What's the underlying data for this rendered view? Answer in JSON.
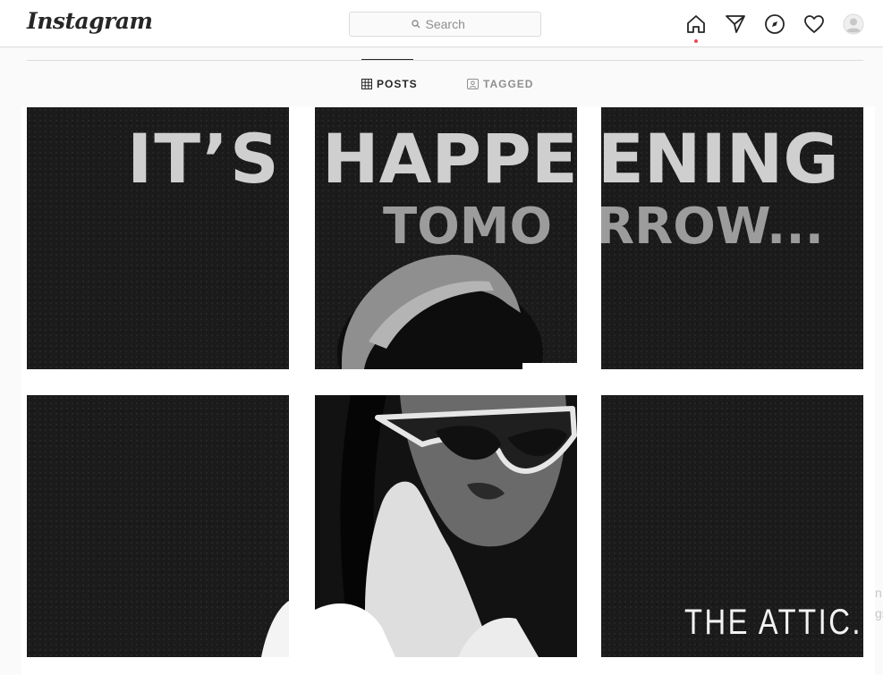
{
  "navbar": {
    "logo_text": "Instagram",
    "search_placeholder": "Search",
    "icons": [
      "home-icon",
      "direct-message-icon",
      "explore-compass-icon",
      "activity-heart-icon",
      "profile-avatar-icon"
    ]
  },
  "profile_tabs": [
    {
      "label": "POSTS",
      "icon": "grid-icon",
      "active": true
    },
    {
      "label": "TAGGED",
      "icon": "tagged-person-icon",
      "active": false
    }
  ],
  "posts": [
    {
      "id": 1,
      "text_line1": "IT’S",
      "text_line2": ""
    },
    {
      "id": 2,
      "text_line1": "HAPPE",
      "text_line2": "TOMO"
    },
    {
      "id": 3,
      "text_line1": "ENING",
      "text_line2": "RROW..."
    },
    {
      "id": 4,
      "text_line1": "",
      "text_line2": ""
    },
    {
      "id": 5,
      "text_line1": "",
      "text_line2": ""
    },
    {
      "id": 6,
      "text_line1": "THE ATTIC.",
      "text_line2": ""
    }
  ],
  "side_clipped_text": [
    "n",
    "gs"
  ],
  "colors": {
    "accent_dot": "#ed4956",
    "border": "#dbdbdb",
    "text": "#262626"
  }
}
